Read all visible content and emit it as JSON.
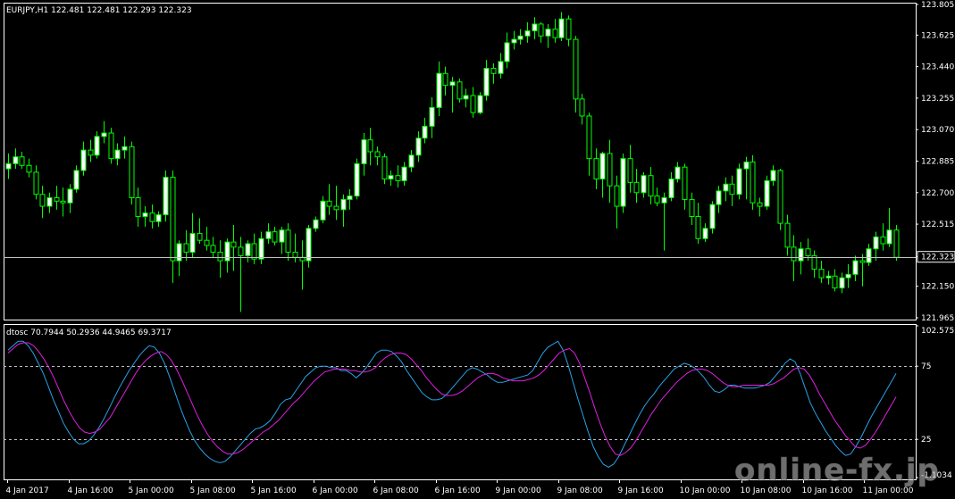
{
  "window": {
    "price_header": "EURJPY,H1  122.481 122.481 122.293 122.323",
    "indicator_header": "dtosc 70.7944 50.2936 44.9465 69.3717",
    "watermark": "online-fx.jp"
  },
  "colors": {
    "background": "#000000",
    "frame": "#ffffff",
    "bull_candle": "#ffffff",
    "bear_candle": "#000000",
    "wick": "#00ff00",
    "price_line": "#c0c0c0",
    "dtosc_fast": "#29a3e8",
    "dtosc_slow": "#e020e0",
    "levels": "#c0c0c0"
  },
  "chart_data": [
    {
      "type": "candlestick",
      "symbol": "EURJPY",
      "timeframe": "H1",
      "ylim": [
        121.965,
        123.805
      ],
      "y_ticks": [
        "123.805",
        "123.625",
        "123.440",
        "123.255",
        "123.070",
        "122.885",
        "122.700",
        "122.515",
        "122.323",
        "122.150",
        "121.965"
      ],
      "current_price": "122.323",
      "x_tick_labels": [
        "4 Jan 2017",
        "4 Jan 16:00",
        "5 Jan 00:00",
        "5 Jan 08:00",
        "5 Jan 16:00",
        "6 Jan 00:00",
        "6 Jan 08:00",
        "6 Jan 16:00",
        "9 Jan 00:00",
        "9 Jan 08:00",
        "9 Jan 16:00",
        "10 Jan 00:00",
        "10 Jan 08:00",
        "10 Jan 16:00",
        "11 Jan 00:00"
      ],
      "ohlc": [
        [
          122.84,
          122.93,
          122.78,
          122.87
        ],
        [
          122.87,
          122.96,
          122.84,
          122.91
        ],
        [
          122.91,
          122.94,
          122.84,
          122.86
        ],
        [
          122.86,
          122.9,
          122.79,
          122.82
        ],
        [
          122.82,
          122.86,
          122.66,
          122.69
        ],
        [
          122.69,
          122.74,
          122.55,
          122.62
        ],
        [
          122.62,
          122.7,
          122.58,
          122.67
        ],
        [
          122.67,
          122.74,
          122.6,
          122.65
        ],
        [
          122.65,
          122.73,
          122.56,
          122.64
        ],
        [
          122.64,
          122.75,
          122.58,
          122.72
        ],
        [
          122.72,
          122.86,
          122.7,
          122.83
        ],
        [
          122.83,
          123.0,
          122.8,
          122.95
        ],
        [
          122.95,
          123.01,
          122.88,
          122.92
        ],
        [
          122.92,
          123.06,
          122.9,
          123.03
        ],
        [
          123.03,
          123.12,
          122.99,
          123.05
        ],
        [
          123.05,
          123.08,
          122.87,
          122.9
        ],
        [
          122.9,
          122.99,
          122.86,
          122.95
        ],
        [
          122.95,
          123.03,
          122.9,
          122.97
        ],
        [
          122.97,
          123.0,
          122.63,
          122.67
        ],
        [
          122.67,
          122.73,
          122.5,
          122.56
        ],
        [
          122.56,
          122.62,
          122.5,
          122.58
        ],
        [
          122.58,
          122.63,
          122.49,
          122.53
        ],
        [
          122.53,
          122.59,
          122.5,
          122.57
        ],
        [
          122.57,
          122.83,
          122.53,
          122.79
        ],
        [
          122.79,
          122.83,
          122.17,
          122.3
        ],
        [
          122.3,
          122.42,
          122.21,
          122.4
        ],
        [
          122.4,
          122.48,
          122.3,
          122.35
        ],
        [
          122.35,
          122.58,
          122.32,
          122.46
        ],
        [
          122.46,
          122.55,
          122.4,
          122.42
        ],
        [
          122.42,
          122.5,
          122.36,
          122.39
        ],
        [
          122.39,
          122.44,
          122.32,
          122.35
        ],
        [
          122.35,
          122.42,
          122.2,
          122.3
        ],
        [
          122.3,
          122.43,
          122.23,
          122.41
        ],
        [
          122.41,
          122.51,
          122.24,
          122.38
        ],
        [
          122.38,
          122.44,
          122.0,
          122.33
        ],
        [
          122.33,
          122.42,
          122.29,
          122.4
        ],
        [
          122.4,
          122.46,
          122.28,
          122.31
        ],
        [
          122.31,
          122.47,
          122.28,
          122.43
        ],
        [
          122.43,
          122.52,
          122.4,
          122.47
        ],
        [
          122.47,
          122.5,
          122.39,
          122.41
        ],
        [
          122.41,
          122.5,
          122.34,
          122.48
        ],
        [
          122.48,
          122.52,
          122.3,
          122.35
        ],
        [
          122.35,
          122.46,
          122.29,
          122.32
        ],
        [
          122.32,
          122.42,
          122.13,
          122.3
        ],
        [
          122.3,
          122.51,
          122.26,
          122.49
        ],
        [
          122.49,
          122.56,
          122.47,
          122.54
        ],
        [
          122.54,
          122.68,
          122.52,
          122.65
        ],
        [
          122.65,
          122.75,
          122.57,
          122.62
        ],
        [
          122.62,
          122.74,
          122.54,
          122.6
        ],
        [
          122.6,
          122.69,
          122.5,
          122.66
        ],
        [
          122.66,
          122.72,
          122.6,
          122.68
        ],
        [
          122.68,
          122.9,
          122.66,
          122.87
        ],
        [
          122.87,
          123.05,
          122.8,
          123.01
        ],
        [
          123.01,
          123.08,
          122.86,
          122.94
        ],
        [
          122.94,
          122.97,
          122.86,
          122.91
        ],
        [
          122.91,
          122.93,
          122.75,
          122.78
        ],
        [
          122.78,
          122.83,
          122.74,
          122.8
        ],
        [
          122.8,
          122.86,
          122.73,
          122.77
        ],
        [
          122.77,
          122.88,
          122.74,
          122.85
        ],
        [
          122.85,
          122.95,
          122.82,
          122.92
        ],
        [
          122.92,
          123.06,
          122.88,
          123.02
        ],
        [
          123.02,
          123.14,
          122.99,
          123.09
        ],
        [
          123.09,
          123.26,
          123.02,
          123.2
        ],
        [
          123.2,
          123.47,
          123.15,
          123.4
        ],
        [
          123.4,
          123.44,
          123.27,
          123.33
        ],
        [
          123.33,
          123.38,
          123.17,
          123.35
        ],
        [
          123.35,
          123.37,
          123.23,
          123.25
        ],
        [
          123.25,
          123.31,
          123.2,
          123.27
        ],
        [
          123.27,
          123.32,
          123.14,
          123.17
        ],
        [
          123.17,
          123.29,
          123.16,
          123.27
        ],
        [
          123.27,
          123.48,
          123.24,
          123.43
        ],
        [
          123.43,
          123.46,
          123.34,
          123.4
        ],
        [
          123.4,
          123.52,
          123.37,
          123.47
        ],
        [
          123.47,
          123.64,
          123.43,
          123.58
        ],
        [
          123.58,
          123.65,
          123.54,
          123.6
        ],
        [
          123.6,
          123.66,
          123.57,
          123.62
        ],
        [
          123.62,
          123.7,
          123.58,
          123.65
        ],
        [
          123.65,
          123.73,
          123.6,
          123.69
        ],
        [
          123.69,
          123.7,
          123.58,
          123.62
        ],
        [
          123.62,
          123.69,
          123.55,
          123.66
        ],
        [
          123.66,
          123.72,
          123.58,
          123.61
        ],
        [
          123.61,
          123.76,
          123.59,
          123.72
        ],
        [
          123.72,
          123.74,
          123.56,
          123.6
        ],
        [
          123.6,
          123.62,
          123.17,
          123.25
        ],
        [
          123.25,
          123.28,
          123.1,
          123.15
        ],
        [
          123.15,
          123.17,
          122.8,
          122.9
        ],
        [
          122.9,
          122.96,
          122.72,
          122.78
        ],
        [
          122.78,
          122.94,
          122.67,
          122.93
        ],
        [
          122.93,
          123.01,
          122.64,
          122.74
        ],
        [
          122.74,
          122.8,
          122.49,
          122.62
        ],
        [
          122.62,
          122.93,
          122.58,
          122.9
        ],
        [
          122.9,
          122.98,
          122.7,
          122.76
        ],
        [
          122.76,
          122.84,
          122.64,
          122.7
        ],
        [
          122.7,
          122.82,
          122.67,
          122.8
        ],
        [
          122.8,
          122.85,
          122.63,
          122.68
        ],
        [
          122.68,
          122.73,
          122.62,
          122.64
        ],
        [
          122.64,
          122.7,
          122.36,
          122.67
        ],
        [
          122.67,
          122.82,
          122.65,
          122.78
        ],
        [
          122.78,
          122.88,
          122.76,
          122.85
        ],
        [
          122.85,
          122.87,
          122.6,
          122.66
        ],
        [
          122.66,
          122.7,
          122.51,
          122.56
        ],
        [
          122.56,
          122.64,
          122.4,
          122.43
        ],
        [
          122.43,
          122.52,
          122.41,
          122.49
        ],
        [
          122.49,
          122.65,
          122.46,
          122.63
        ],
        [
          122.63,
          122.74,
          122.58,
          122.71
        ],
        [
          122.71,
          122.79,
          122.65,
          122.75
        ],
        [
          122.75,
          122.8,
          122.62,
          122.69
        ],
        [
          122.69,
          122.87,
          122.66,
          122.84
        ],
        [
          122.84,
          122.91,
          122.66,
          122.88
        ],
        [
          122.88,
          122.92,
          122.6,
          122.64
        ],
        [
          122.64,
          122.67,
          122.56,
          122.62
        ],
        [
          122.62,
          122.8,
          122.6,
          122.77
        ],
        [
          122.77,
          122.86,
          122.74,
          122.83
        ],
        [
          122.83,
          122.84,
          122.48,
          122.52
        ],
        [
          122.52,
          122.57,
          122.33,
          122.38
        ],
        [
          122.38,
          122.45,
          122.18,
          122.3
        ],
        [
          122.3,
          122.41,
          122.22,
          122.37
        ],
        [
          122.37,
          122.43,
          122.3,
          122.33
        ],
        [
          122.33,
          122.36,
          122.2,
          122.25
        ],
        [
          122.25,
          122.3,
          122.17,
          122.2
        ],
        [
          122.2,
          122.24,
          122.16,
          122.21
        ],
        [
          122.21,
          122.25,
          122.12,
          122.14
        ],
        [
          122.14,
          122.23,
          122.11,
          122.2
        ],
        [
          122.2,
          122.28,
          122.14,
          122.22
        ],
        [
          122.22,
          122.33,
          122.18,
          122.3
        ],
        [
          122.3,
          122.34,
          122.15,
          122.29
        ],
        [
          122.29,
          122.4,
          122.27,
          122.37
        ],
        [
          122.37,
          122.47,
          122.3,
          122.44
        ],
        [
          122.44,
          122.52,
          122.36,
          122.4
        ],
        [
          122.4,
          122.61,
          122.38,
          122.48
        ],
        [
          122.48,
          122.51,
          122.3,
          122.32
        ]
      ]
    },
    {
      "type": "line",
      "title": "dtosc 70.7944 50.2936 44.9465 69.3717",
      "ylim": [
        -1.1034,
        102.5755
      ],
      "y_ticks": [
        "102.5755",
        "75",
        "25",
        "-1.1034"
      ],
      "levels": [
        75,
        25
      ],
      "series": [
        {
          "color": "#29a3e8",
          "values": [
            86,
            89,
            92,
            92,
            89,
            84,
            77,
            70,
            61,
            52,
            44,
            36,
            30,
            25,
            22,
            22,
            24,
            28,
            33,
            39,
            46,
            53,
            60,
            66,
            72,
            77,
            82,
            86,
            89,
            88,
            84,
            77,
            68,
            58,
            48,
            39,
            31,
            24,
            19,
            15,
            12,
            10,
            9,
            10,
            13,
            17,
            21,
            25,
            29,
            32,
            33,
            35,
            38,
            43,
            49,
            52,
            53,
            58,
            63,
            68,
            71,
            74,
            75,
            75,
            74,
            74,
            72,
            72,
            70,
            67,
            70,
            74,
            79,
            84,
            86,
            86,
            85,
            82,
            78,
            72,
            67,
            62,
            57,
            54,
            52,
            52,
            53,
            56,
            60,
            64,
            68,
            72,
            74,
            73,
            71,
            69,
            66,
            64,
            64,
            65,
            66,
            67,
            68,
            69,
            72,
            78,
            84,
            88,
            90,
            92,
            86,
            76,
            64,
            52,
            41,
            30,
            20,
            13,
            8,
            6,
            8,
            13,
            20,
            27,
            34,
            41,
            47,
            52,
            56,
            61,
            65,
            69,
            73,
            75,
            77,
            76,
            74,
            71,
            67,
            62,
            58,
            57,
            59,
            62,
            62,
            61,
            60,
            60,
            60,
            61,
            62,
            64,
            68,
            72,
            77,
            80,
            78,
            70,
            60,
            50,
            43,
            37,
            31,
            26,
            21,
            17,
            14,
            15,
            20,
            26,
            33,
            40,
            46,
            52,
            58,
            64,
            70
          ],
          "current": "70.7944"
        },
        {
          "color": "#e020e0",
          "values": [
            84,
            87,
            90,
            91,
            91,
            89,
            85,
            80,
            74,
            67,
            59,
            51,
            44,
            38,
            33,
            30,
            29,
            30,
            32,
            36,
            40,
            46,
            52,
            58,
            64,
            70,
            75,
            79,
            82,
            84,
            85,
            83,
            79,
            73,
            66,
            58,
            50,
            42,
            35,
            29,
            24,
            20,
            17,
            15,
            15,
            16,
            18,
            21,
            24,
            27,
            30,
            32,
            35,
            38,
            42,
            46,
            50,
            53,
            57,
            61,
            65,
            68,
            71,
            72,
            73,
            73,
            73,
            72,
            72,
            71,
            71,
            72,
            74,
            78,
            81,
            83,
            84,
            84,
            83,
            80,
            76,
            72,
            67,
            63,
            59,
            56,
            55,
            55,
            56,
            58,
            61,
            64,
            67,
            69,
            70,
            70,
            69,
            67,
            66,
            65,
            65,
            65,
            66,
            67,
            69,
            72,
            76,
            80,
            84,
            86,
            87,
            84,
            77,
            67,
            57,
            46,
            36,
            27,
            20,
            15,
            14,
            16,
            19,
            24,
            30,
            36,
            42,
            47,
            52,
            56,
            60,
            64,
            67,
            70,
            72,
            73,
            73,
            72,
            70,
            67,
            64,
            62,
            61,
            61,
            62,
            62,
            62,
            62,
            62,
            62,
            63,
            65,
            67,
            70,
            73,
            74,
            73,
            69,
            63,
            56,
            50,
            44,
            38,
            33,
            28,
            24,
            20,
            19,
            21,
            25,
            30,
            36,
            42,
            48,
            54
          ],
          "current": "50.2936"
        }
      ]
    }
  ]
}
